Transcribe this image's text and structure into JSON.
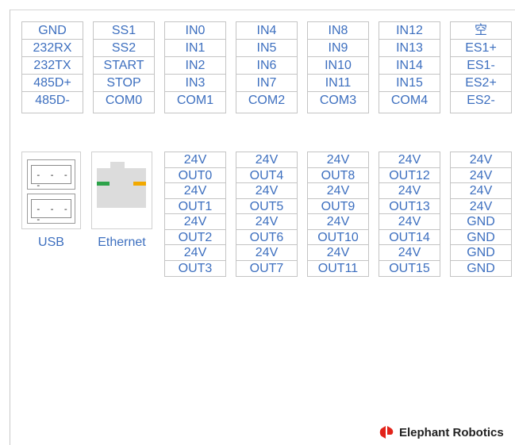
{
  "top_blocks": [
    [
      "GND",
      "232RX",
      "232TX",
      "485D+",
      "485D-"
    ],
    [
      "SS1",
      "SS2",
      "START",
      "STOP",
      "COM0"
    ],
    [
      "IN0",
      "IN1",
      "IN2",
      "IN3",
      "COM1"
    ],
    [
      "IN4",
      "IN5",
      "IN6",
      "IN7",
      "COM2"
    ],
    [
      "IN8",
      "IN9",
      "IN10",
      "IN11",
      "COM3"
    ],
    [
      "IN12",
      "IN13",
      "IN14",
      "IN15",
      "COM4"
    ],
    [
      "空",
      "ES1+",
      "ES1-",
      "ES2+",
      "ES2-"
    ]
  ],
  "bottom_blocks": [
    [
      "24V",
      "OUT0",
      "24V",
      "OUT1",
      "24V",
      "OUT2",
      "24V",
      "OUT3"
    ],
    [
      "24V",
      "OUT4",
      "24V",
      "OUT5",
      "24V",
      "OUT6",
      "24V",
      "OUT7"
    ],
    [
      "24V",
      "OUT8",
      "24V",
      "OUT9",
      "24V",
      "OUT10",
      "24V",
      "OUT11"
    ],
    [
      "24V",
      "OUT12",
      "24V",
      "OUT13",
      "24V",
      "OUT14",
      "24V",
      "OUT15"
    ],
    [
      "24V",
      "24V",
      "24V",
      "24V",
      "GND",
      "GND",
      "GND",
      "GND"
    ]
  ],
  "ports": {
    "usb_label": "USB",
    "ethernet_label": "Ethernet"
  },
  "brand": {
    "name": "Elephant Robotics",
    "logo_icon": "elephant-robotics-logo-icon",
    "logo_color": "#e2231a"
  },
  "colors": {
    "label_text": "#3d6fbf",
    "border": "#c4c4c4",
    "led_green": "#2da34a",
    "led_orange": "#f2a900"
  }
}
